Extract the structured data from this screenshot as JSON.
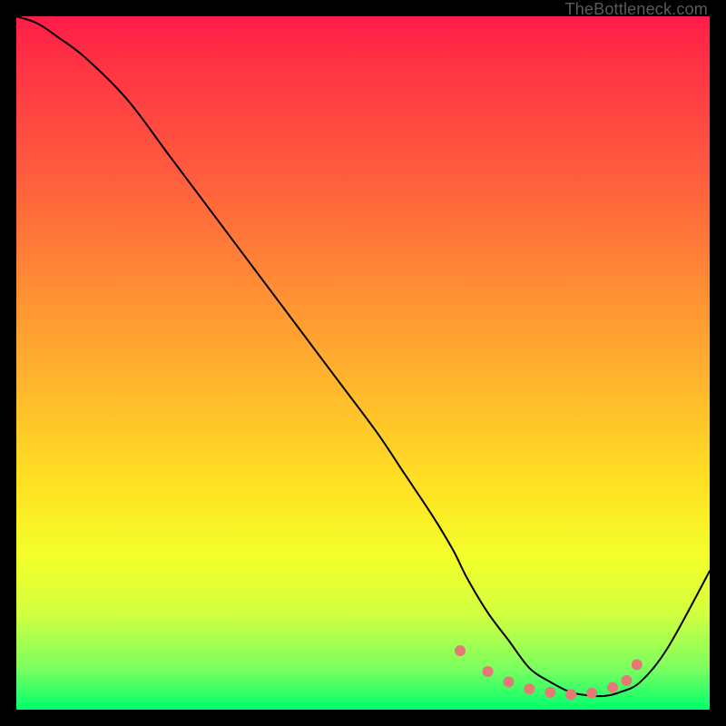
{
  "watermark": "TheBottleneck.com",
  "chart_data": {
    "type": "line",
    "title": "",
    "xlabel": "",
    "ylabel": "",
    "xlim": [
      0,
      100
    ],
    "ylim": [
      0,
      100
    ],
    "series": [
      {
        "name": "bottleneck-curve",
        "x": [
          0,
          3,
          6,
          10,
          16,
          22,
          28,
          34,
          40,
          46,
          52,
          56,
          60,
          63,
          65,
          68,
          71,
          74,
          77,
          80,
          83,
          85,
          87,
          90,
          94,
          100
        ],
        "y": [
          100,
          99,
          97,
          94,
          88,
          80,
          72,
          64,
          56,
          48,
          40,
          34,
          28,
          23,
          19,
          14,
          10,
          6,
          4,
          2.5,
          2,
          2,
          2.5,
          4,
          9,
          20
        ],
        "stroke": "#000000",
        "stroke_width": 2
      }
    ],
    "dots": {
      "color": "#e47a75",
      "radius": 6,
      "points": [
        {
          "x": 64,
          "y": 8.5
        },
        {
          "x": 68,
          "y": 5.5
        },
        {
          "x": 71,
          "y": 4
        },
        {
          "x": 74,
          "y": 3
        },
        {
          "x": 77,
          "y": 2.5
        },
        {
          "x": 80,
          "y": 2.2
        },
        {
          "x": 83,
          "y": 2.4
        },
        {
          "x": 86,
          "y": 3.2
        },
        {
          "x": 88,
          "y": 4.2
        },
        {
          "x": 89.5,
          "y": 6.5
        }
      ]
    }
  }
}
